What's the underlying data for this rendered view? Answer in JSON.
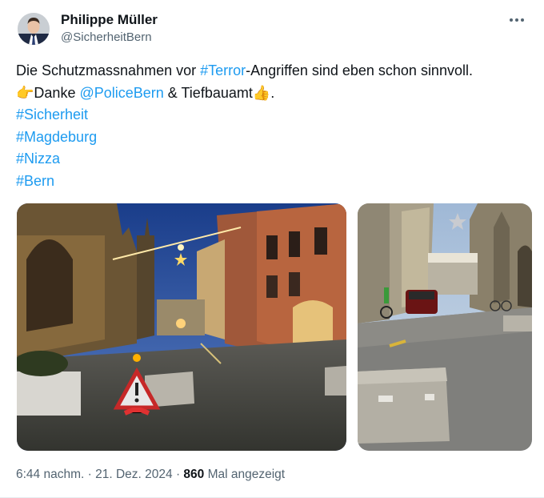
{
  "author": {
    "name": "Philippe Müller",
    "handle": "@SicherheitBern"
  },
  "tweet": {
    "line1_text_a": "Die Schutzmassnahmen vor ",
    "line1_hashtag": "#Terror",
    "line1_text_b": "-Angriffen sind eben schon sinnvoll.",
    "line2_emoji_point": "👉",
    "line2_text_a": "Danke ",
    "line2_mention": "@PoliceBern",
    "line2_text_b": " & Tiefbauamt",
    "line2_emoji_thumb": "👍",
    "line2_text_c": ".",
    "hashtags": [
      "#Sicherheit",
      "#Magdeburg",
      "#Nizza",
      "#Bern"
    ]
  },
  "meta": {
    "time": "6:44 nachm.",
    "separator": "·",
    "date": "21. Dez. 2024",
    "views_count": "860",
    "views_label": "Mal angezeigt"
  },
  "images": [
    {
      "name": "night-street-barriers-photo"
    },
    {
      "name": "day-street-barriers-photo"
    }
  ],
  "colors": {
    "link": "#1d9bf0",
    "text": "#0f1419",
    "secondary": "#536471"
  },
  "icons": {
    "more": "more-horizontal-icon"
  }
}
